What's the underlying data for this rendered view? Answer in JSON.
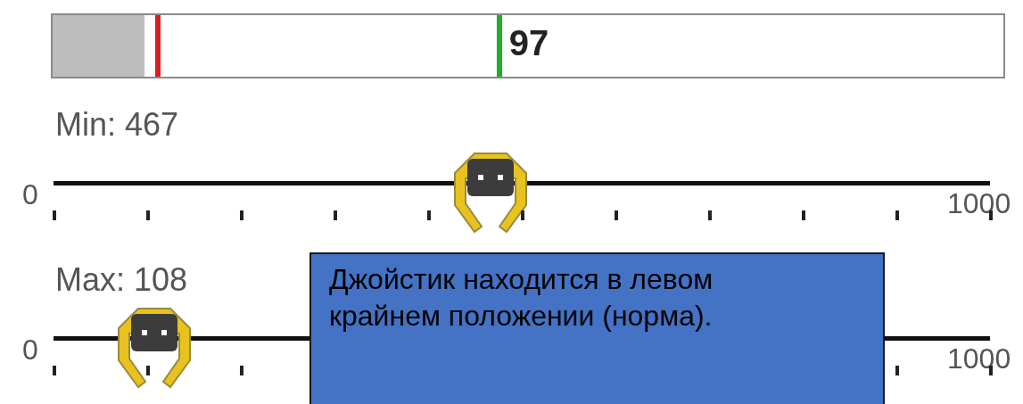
{
  "meter": {
    "level": 0.097,
    "reading": "97"
  },
  "sliders": [
    {
      "kind": "min",
      "label": "Min: 467",
      "level": 0.467,
      "min_label": "0",
      "max_label": "1000"
    },
    {
      "kind": "max",
      "label": "Max: 108",
      "level": 0.108,
      "min_label": "0",
      "max_label": "1000"
    }
  ],
  "callout": {
    "text": "Джойстик находится в левом крайнем положении (норма)."
  }
}
